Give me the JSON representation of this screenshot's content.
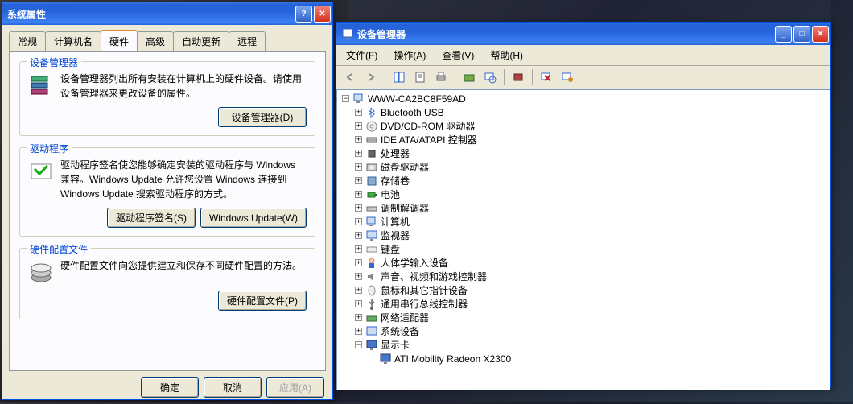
{
  "sysprop": {
    "title": "系统属性",
    "tabs": [
      "常规",
      "计算机名",
      "硬件",
      "高级",
      "自动更新",
      "远程"
    ],
    "active_tab": 2,
    "sections": {
      "devmgr": {
        "title": "设备管理器",
        "text": "设备管理器列出所有安装在计算机上的硬件设备。请使用设备管理器来更改设备的属性。",
        "button": "设备管理器(D)"
      },
      "drivers": {
        "title": "驱动程序",
        "text": "驱动程序签名使您能够确定安装的驱动程序与 Windows 兼容。Windows Update 允许您设置 Windows 连接到 Windows Update 搜索驱动程序的方式。",
        "button1": "驱动程序签名(S)",
        "button2": "Windows Update(W)"
      },
      "profiles": {
        "title": "硬件配置文件",
        "text": "硬件配置文件向您提供建立和保存不同硬件配置的方法。",
        "button": "硬件配置文件(P)"
      }
    },
    "buttons": {
      "ok": "确定",
      "cancel": "取消",
      "apply": "应用(A)"
    }
  },
  "devmgr": {
    "title": "设备管理器",
    "menu": [
      "文件(F)",
      "操作(A)",
      "查看(V)",
      "帮助(H)"
    ],
    "tree": {
      "root": "WWW-CA2BC8F59AD",
      "children": [
        {
          "label": "Bluetooth USB",
          "icon": "bluetooth"
        },
        {
          "label": "DVD/CD-ROM 驱动器",
          "icon": "disc"
        },
        {
          "label": "IDE ATA/ATAPI 控制器",
          "icon": "ide"
        },
        {
          "label": "处理器",
          "icon": "cpu"
        },
        {
          "label": "磁盘驱动器",
          "icon": "disk"
        },
        {
          "label": "存储卷",
          "icon": "volume"
        },
        {
          "label": "电池",
          "icon": "battery"
        },
        {
          "label": "调制解调器",
          "icon": "modem"
        },
        {
          "label": "计算机",
          "icon": "computer"
        },
        {
          "label": "监视器",
          "icon": "monitor"
        },
        {
          "label": "键盘",
          "icon": "keyboard"
        },
        {
          "label": "人体学输入设备",
          "icon": "hid"
        },
        {
          "label": "声音、视频和游戏控制器",
          "icon": "sound"
        },
        {
          "label": "鼠标和其它指针设备",
          "icon": "mouse"
        },
        {
          "label": "通用串行总线控制器",
          "icon": "usb"
        },
        {
          "label": "网络适配器",
          "icon": "network"
        },
        {
          "label": "系统设备",
          "icon": "system"
        },
        {
          "label": "显示卡",
          "icon": "display",
          "expanded": true,
          "children": [
            {
              "label": "ATI Mobility Radeon X2300",
              "icon": "display"
            }
          ]
        }
      ]
    }
  }
}
